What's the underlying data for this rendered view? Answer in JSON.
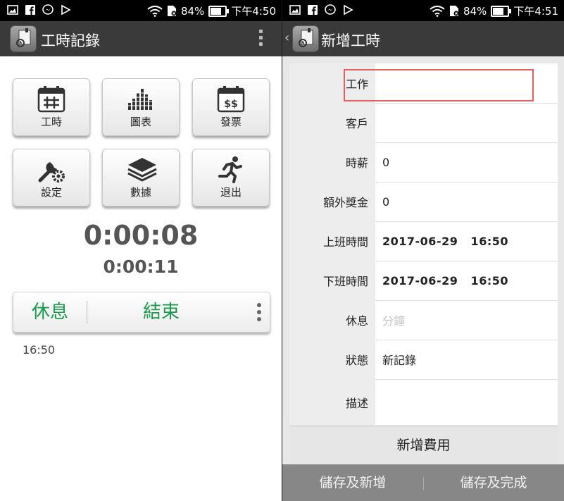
{
  "status_left": {
    "battery": "84%",
    "time": "下午4:50",
    "battery_level": 0.84
  },
  "status_right": {
    "battery": "84%",
    "time": "下午4:51",
    "battery_level": 0.84
  },
  "left_screen": {
    "title": "工時記錄",
    "tiles": [
      {
        "label": "工時",
        "icon": "calendar-grid-icon"
      },
      {
        "label": "圖表",
        "icon": "bar-chart-icon"
      },
      {
        "label": "發票",
        "icon": "invoice-calendar-icon"
      },
      {
        "label": "設定",
        "icon": "wrench-gear-icon"
      },
      {
        "label": "數據",
        "icon": "layers-icon"
      },
      {
        "label": "退出",
        "icon": "running-man-icon"
      }
    ],
    "timer_main": "0:00:08",
    "timer_secondary": "0:00:11",
    "rest_button": "休息",
    "end_button": "結束",
    "start_time": "16:50",
    "accent_color": "#1a9a4b"
  },
  "right_screen": {
    "title": "新增工時",
    "fields": [
      {
        "label": "工作",
        "value": ""
      },
      {
        "label": "客戶",
        "value": ""
      },
      {
        "label": "時薪",
        "value": "0"
      },
      {
        "label": "額外獎金",
        "value": "0"
      },
      {
        "label": "上班時間",
        "value": "2017-06-29   16:50"
      },
      {
        "label": "下班時間",
        "value": "2017-06-29   16:50"
      },
      {
        "label": "休息",
        "placeholder": "分鐘"
      },
      {
        "label": "狀態",
        "value": "新記錄"
      },
      {
        "label": "描述",
        "value": ""
      }
    ],
    "add_expense": "新增費用",
    "save_and_add": "儲存及新增",
    "save_and_finish": "儲存及完成",
    "highlight_color": "#e06060"
  }
}
